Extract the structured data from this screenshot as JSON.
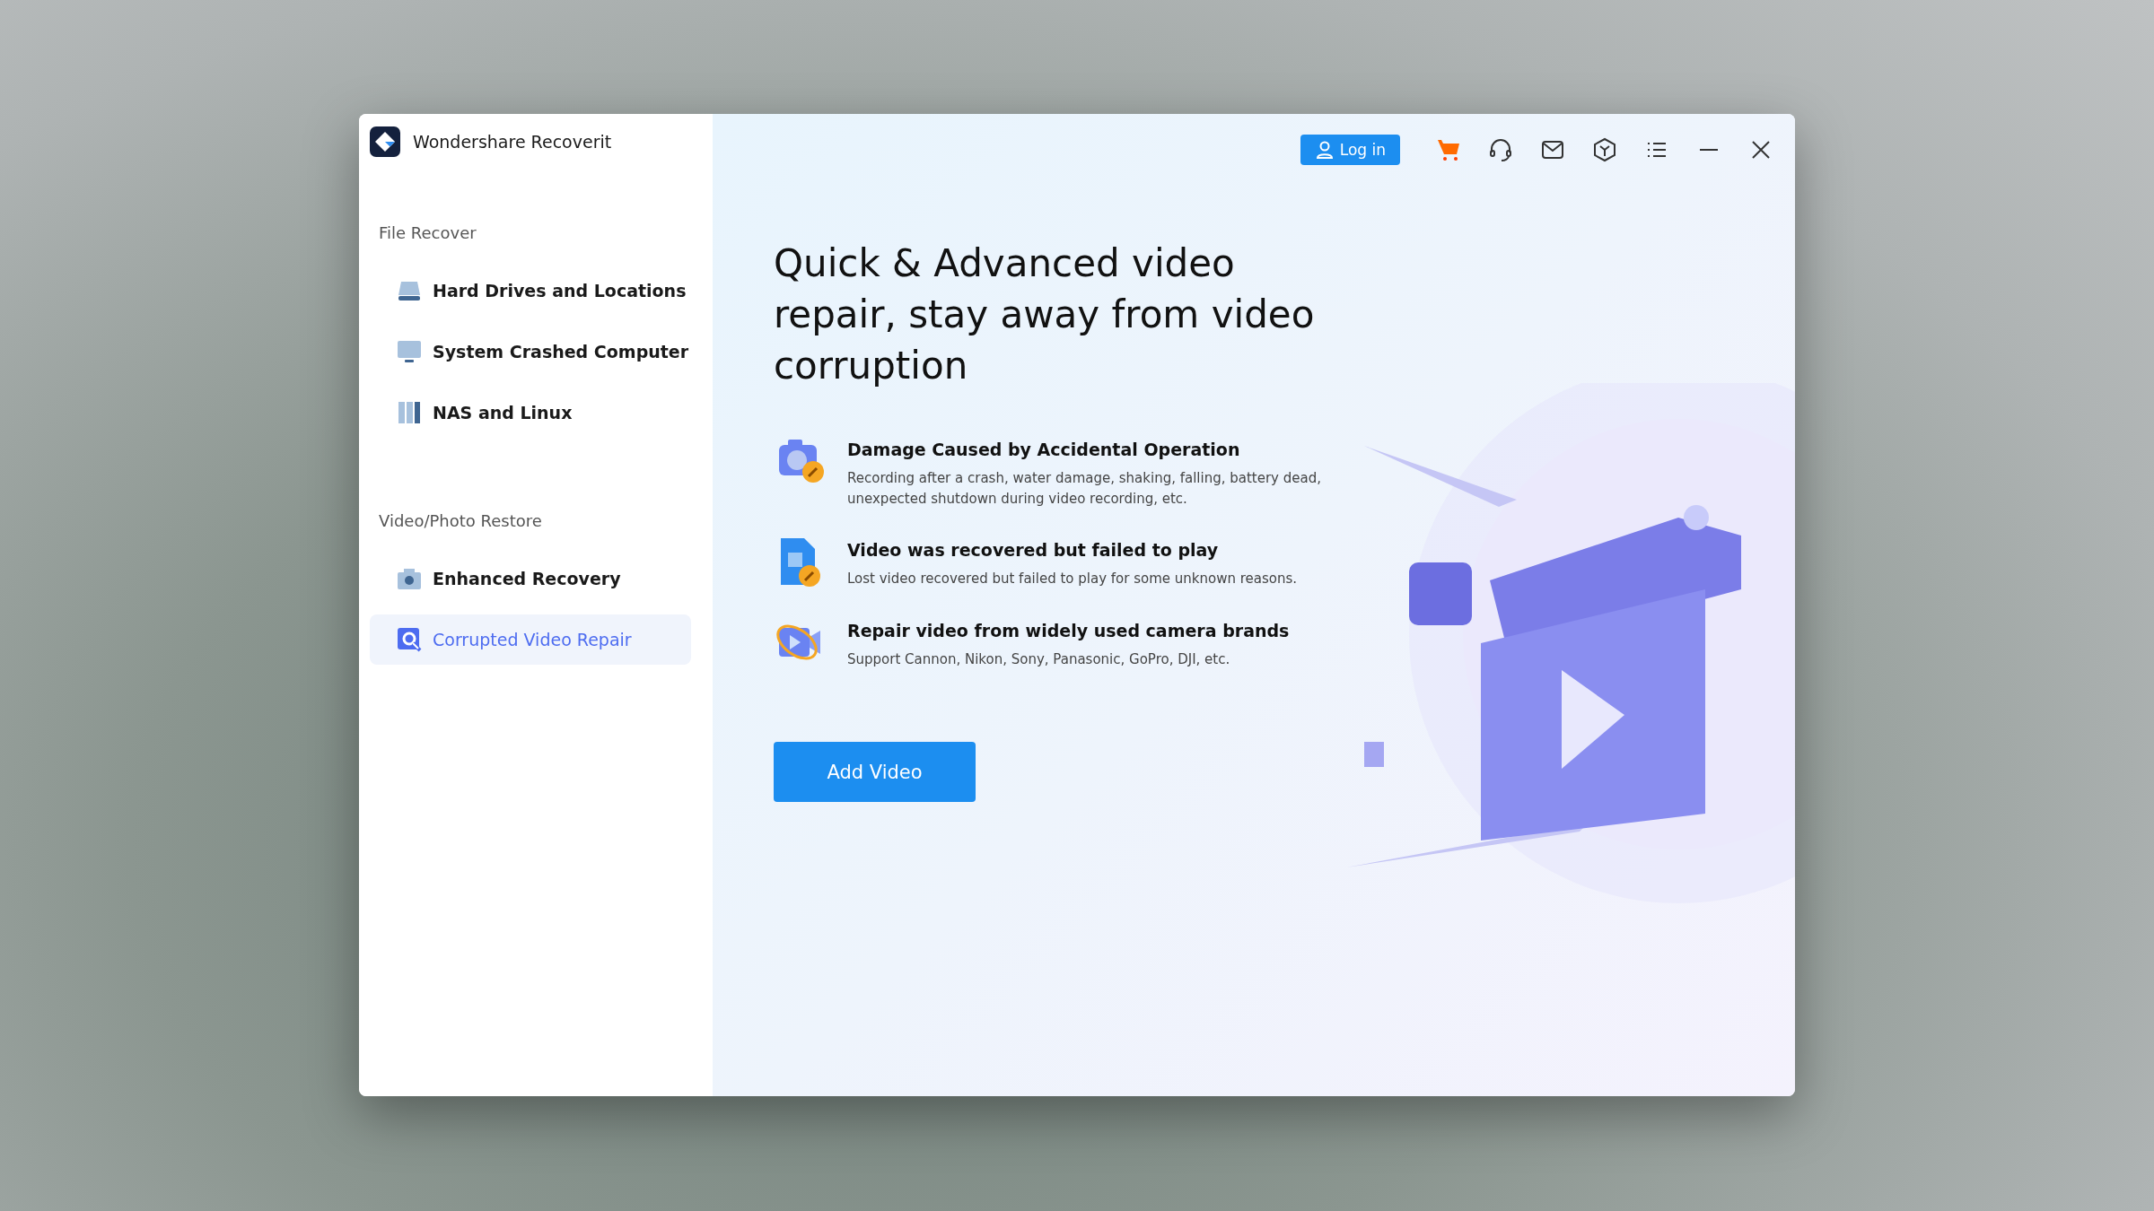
{
  "window": {
    "title": "Wondershare Recoverit"
  },
  "toolbar": {
    "login_label": "Log in"
  },
  "sidebar": {
    "sections": [
      {
        "heading": "File Recover",
        "items": [
          {
            "label": "Hard Drives and Locations",
            "kind": "drive",
            "selected": false
          },
          {
            "label": "System Crashed Computer",
            "kind": "monitor",
            "selected": false
          },
          {
            "label": "NAS and Linux",
            "kind": "nas",
            "selected": false
          }
        ]
      },
      {
        "heading": "Video/Photo Restore",
        "items": [
          {
            "label": "Enhanced Recovery",
            "kind": "camera",
            "selected": false
          },
          {
            "label": "Corrupted Video Repair",
            "kind": "repair",
            "selected": true
          }
        ]
      }
    ]
  },
  "main": {
    "heading": "Quick & Advanced video repair, stay away from video corruption",
    "features": [
      {
        "kind": "camera",
        "title": "Damage Caused by Accidental Operation",
        "description": "Recording after a crash, water damage, shaking, falling, battery dead, unexpected shutdown during video recording, etc."
      },
      {
        "kind": "file",
        "title": "Video was recovered but failed to play",
        "description": "Lost video recovered but failed to play for some unknown reasons."
      },
      {
        "kind": "video",
        "title": "Repair video from widely used camera brands",
        "description": "Support Cannon, Nikon, Sony, Panasonic, GoPro, DJI, etc."
      }
    ],
    "button": "Add Video"
  }
}
